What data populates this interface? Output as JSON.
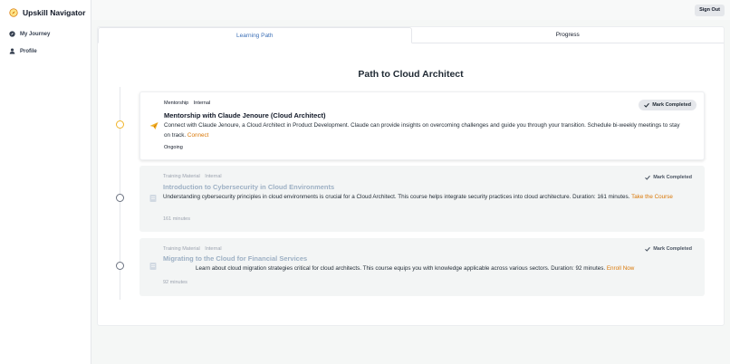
{
  "app": {
    "title": "Upskill Navigator"
  },
  "sidebar": {
    "items": [
      {
        "label": "My Journey",
        "icon": "compass-icon"
      },
      {
        "label": "Profile",
        "icon": "user-icon"
      }
    ]
  },
  "header": {
    "sign_out_label": "Sign Out"
  },
  "tabs": [
    {
      "label": "Learning Path",
      "active": true
    },
    {
      "label": "Progress",
      "active": false
    }
  ],
  "path": {
    "title": "Path to Cloud Architect",
    "items": [
      {
        "type": "Mentorship",
        "source": "Internal",
        "title": "Mentorship with Claude Jenoure (Cloud Architect)",
        "description": "Connect with Claude Jenoure, a Cloud Architect in Product Development. Claude can provide insights on overcoming challenges and guide you through your transition. Schedule bi-weekly meetings to stay on track.",
        "link_label": "Connect",
        "status": "Ongoing",
        "button_label": "Mark Completed",
        "icon": "paper-plane-icon"
      },
      {
        "type": "Training Material",
        "source": "Internal",
        "title": "Introduction to Cybersecurity in Cloud Environments",
        "description": "Understanding cybersecurity principles in cloud environments is crucial for a Cloud Architect. This course helps integrate security practices into cloud architecture. Duration: 161 minutes.",
        "link_label": "Take the Course",
        "status": "161 minutes",
        "button_label": "Mark Completed",
        "icon": "book-icon"
      },
      {
        "type": "Training Material",
        "source": "Internal",
        "title": "Migrating to the Cloud for Financial Services",
        "description": "Learn about cloud migration strategies critical for cloud architects. This course equips you with knowledge applicable across various sectors. Duration: 92 minutes.",
        "link_label": "Enroll Now",
        "status": "92 minutes",
        "button_label": "Mark Completed",
        "icon": "book-icon"
      }
    ]
  },
  "colors": {
    "accent": "#3b6fb6",
    "link": "#d97706",
    "active_dot": "#f0b429"
  }
}
